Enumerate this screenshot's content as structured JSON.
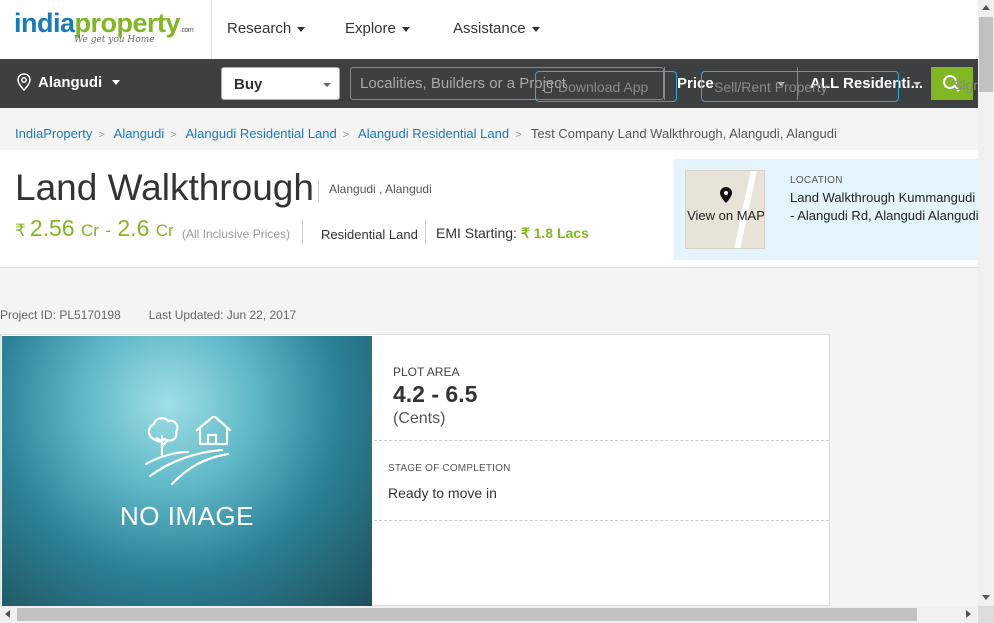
{
  "brand": {
    "name_part1": "india",
    "name_part2": "property",
    "suffix": ".com",
    "tagline": "We get you Home"
  },
  "nav": {
    "items": [
      {
        "label": "Research"
      },
      {
        "label": "Explore"
      },
      {
        "label": "Assistance"
      }
    ]
  },
  "search": {
    "city": "Alangudi",
    "mode": "Buy",
    "placeholder": "Localities, Builders or a Project",
    "download_app": "Download App",
    "price": "Price",
    "sell_rent": "Sell/Rent Property",
    "property_type": "ALL Residenti...",
    "sign_in": "Sign In"
  },
  "breadcrumb": {
    "items": [
      "IndiaProperty",
      "Alangudi",
      "Alangudi Residential Land",
      "Alangudi Residential Land"
    ],
    "current": "Test Company Land Walkthrough, Alangudi, Alangudi"
  },
  "project": {
    "title": "Land Walkthrough",
    "location": "Alangudi , Alangudi",
    "price_symbol": "₹",
    "price_low": "2.56",
    "price_low_unit": "Cr",
    "price_sep": "-",
    "price_high": "2.6",
    "price_high_unit": "Cr",
    "price_note": "(All Inclusive Prices)",
    "type": "Residential Land",
    "emi_label": "EMI Starting:",
    "emi_value": "₹ 1.8 Lacs"
  },
  "location_box": {
    "map_label": "View on MAP",
    "label": "LOCATION",
    "address": "Land Walkthrough Kummangudi - Alangudi Rd, Alangudi Alangudi"
  },
  "meta": {
    "project_id": "Project ID: PL5170198",
    "last_updated": "Last Updated: Jun 22, 2017"
  },
  "details": {
    "no_image": "NO IMAGE",
    "plot_area_label": "PLOT AREA",
    "plot_area_value": "4.2 - 6.5",
    "plot_area_unit": "(Cents)",
    "stage_label": "STAGE OF COMPLETION",
    "stage_value": "Ready to move in"
  },
  "colors": {
    "brand_blue": "#1a7ab6",
    "brand_green": "#82b625",
    "dark_bar": "#3e3f40",
    "location_bg": "#e3f4fc"
  }
}
